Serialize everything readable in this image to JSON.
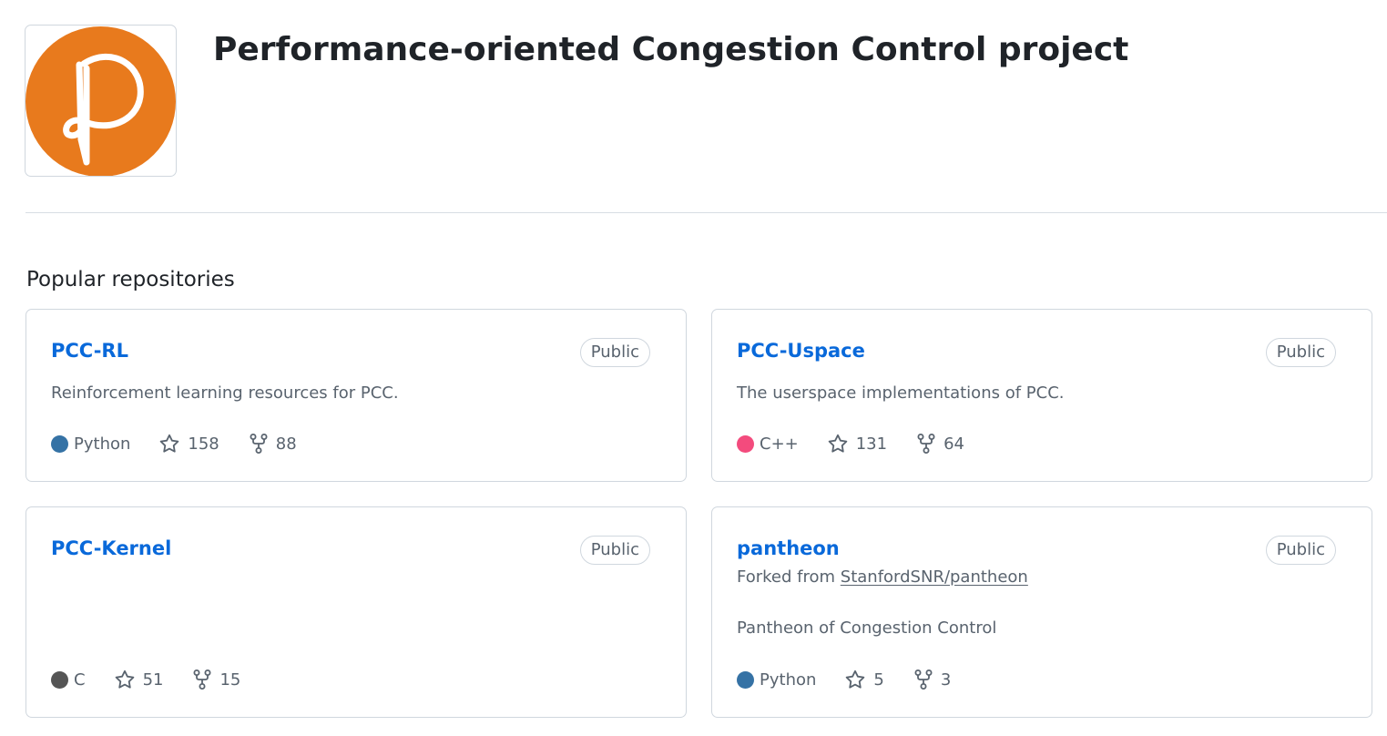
{
  "org": {
    "name": "Performance-oriented Congestion Control project",
    "avatar": {
      "icon": "pcc-logo-icon",
      "color": "#e87a1d"
    }
  },
  "popular": {
    "heading": "Popular repositories",
    "repos": [
      {
        "name": "PCC-RL",
        "visibility": "Public",
        "description": "Reinforcement learning resources for PCC.",
        "language": "Python",
        "language_color": "#3572A5",
        "stars": "158",
        "forks": "88"
      },
      {
        "name": "PCC-Uspace",
        "visibility": "Public",
        "description": "The userspace implementations of PCC.",
        "language": "C++",
        "language_color": "#f34b7d",
        "stars": "131",
        "forks": "64"
      },
      {
        "name": "PCC-Kernel",
        "visibility": "Public",
        "description": "",
        "language": "C",
        "language_color": "#555555",
        "stars": "51",
        "forks": "15"
      },
      {
        "name": "pantheon",
        "visibility": "Public",
        "forked_prefix": "Forked from",
        "forked_from": "StanfordSNR/pantheon",
        "description": "Pantheon of Congestion Control",
        "language": "Python",
        "language_color": "#3572A5",
        "stars": "5",
        "forks": "3"
      }
    ]
  },
  "icons": {
    "star": "star-icon",
    "fork": "repo-forked-icon"
  }
}
